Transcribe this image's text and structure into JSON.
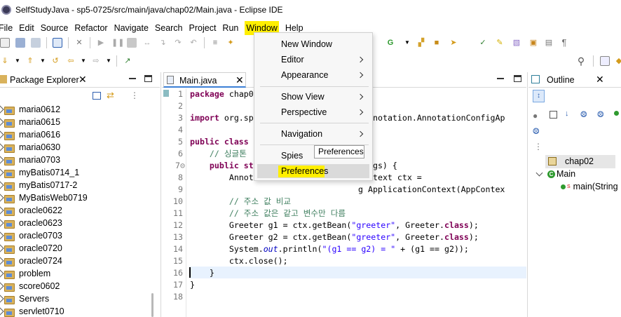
{
  "window": {
    "title": "SelfStudyJava - sp5-0725/src/main/java/chap02/Main.java - Eclipse IDE"
  },
  "menubar": [
    "File",
    "Edit",
    "Source",
    "Refactor",
    "Navigate",
    "Search",
    "Project",
    "Run",
    "Window",
    "Help"
  ],
  "window_menu": {
    "items": [
      {
        "label": "New Window",
        "submenu": false
      },
      {
        "label": "Editor",
        "submenu": true
      },
      {
        "label": "Appearance",
        "submenu": true
      },
      {
        "label": "Show View",
        "submenu": true
      },
      {
        "label": "Perspective",
        "submenu": true
      },
      {
        "label": "Navigation",
        "submenu": true
      },
      {
        "label": "Spies",
        "submenu": true
      },
      {
        "label": "Preferences",
        "submenu": false
      }
    ],
    "tooltip": "Preferences",
    "highlight_color": "#ffef00"
  },
  "package_explorer": {
    "title": "Package Explorer",
    "items": [
      "maria0612",
      "maria0615",
      "maria0616",
      "maria0630",
      "maria0703",
      "myBatis0714_1",
      "myBatis0717-2",
      "MyBatisWeb0719",
      "oracle0622",
      "oracle0623",
      "oracle0703",
      "oracle0720",
      "oracle0724",
      "problem",
      "score0602",
      "Servers",
      "servlet0710"
    ]
  },
  "editor": {
    "tab": "Main.java",
    "line_numbers": [
      "1",
      "2",
      "3",
      "4",
      "5",
      "6",
      "7⊝",
      "8",
      "9",
      "10",
      "11",
      "12",
      "13",
      "14",
      "15",
      "16",
      "17",
      "18"
    ],
    "lines": {
      "l1_kw": "package",
      "l1_rest": " chap0",
      "l3_kw": "import",
      "l3_a": " org.sp",
      "l3_b": "notation.AnnotationConfigAp",
      "l5_kw": "public class",
      "l6_cmt": "    // 싱글톤",
      "l7_kw": "    public st",
      "l7_b": "args) {",
      "l8_a": "        Annot",
      "l8_b": "ntext ctx =",
      "l9_b": "g ApplicationContext(AppContex",
      "l10_cmt": "        // 주소 값 비교",
      "l11_cmt": "        // 주소 값은 같고 변수만 다름",
      "l12_a": "        Greeter g1 = ctx.getBean(",
      "l12_str": "\"greeter\"",
      "l12_b": ", Greeter.",
      "l12_kw": "class",
      "l12_c": ");",
      "l13_a": "        Greeter g2 = ctx.getBean(",
      "l13_str": "\"greeter\"",
      "l13_b": ", Greeter.",
      "l13_kw": "class",
      "l13_c": ");",
      "l14_a": "        System.",
      "l14_fld": "out",
      "l14_b": ".println(",
      "l14_str": "\"(g1 == g2) = \"",
      "l14_c": " + (g1 == g2));",
      "l15": "        ctx.close();",
      "l16": "    }",
      "l17": "}"
    }
  },
  "outline": {
    "title": "Outline",
    "items": [
      {
        "label": "chap02"
      },
      {
        "label": "Main"
      },
      {
        "label": "main(String"
      }
    ]
  }
}
